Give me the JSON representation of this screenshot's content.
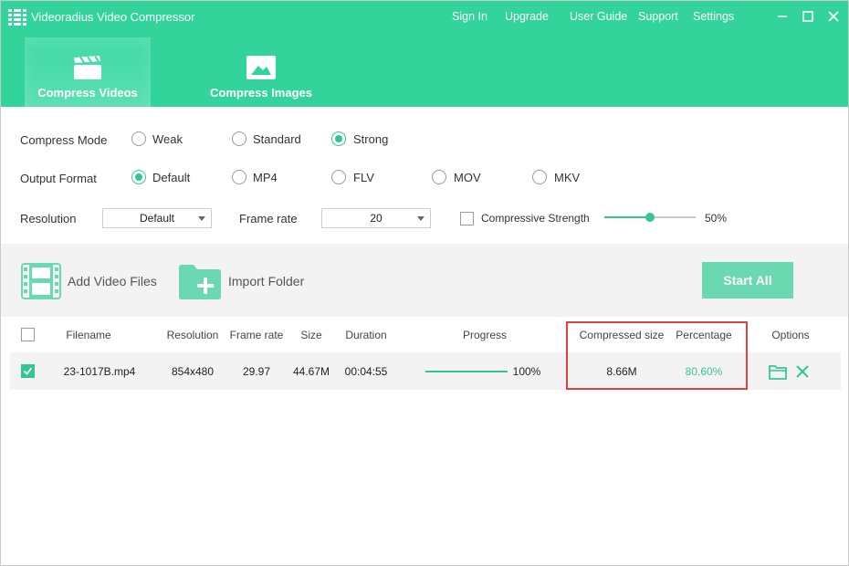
{
  "window": {
    "title": "Videoradius Video Compressor",
    "nav": [
      "Sign In",
      "Upgrade",
      "User Guide",
      "Support",
      "Settings"
    ]
  },
  "tabs": [
    {
      "label": "Compress Videos",
      "icon": "clapperboard-icon",
      "active": true
    },
    {
      "label": "Compress Images",
      "icon": "image-icon",
      "active": false
    }
  ],
  "settings": {
    "compress_mode": {
      "label": "Compress Mode",
      "options": [
        "Weak",
        "Standard",
        "Strong"
      ],
      "selected": "Strong"
    },
    "output_format": {
      "label": "Output Format",
      "options": [
        "Default",
        "MP4",
        "FLV",
        "MOV",
        "MKV"
      ],
      "selected": "Default"
    },
    "resolution": {
      "label": "Resolution",
      "value": "Default"
    },
    "frame_rate": {
      "label": "Frame rate",
      "value": "20"
    },
    "compressive_strength": {
      "label": "Compressive Strength",
      "checked": false,
      "value_text": "50%",
      "value": 50
    }
  },
  "toolbar": {
    "add_video_label": "Add Video Files",
    "import_folder_label": "Import Folder",
    "start_all_label": "Start All"
  },
  "table": {
    "columns": [
      "Filename",
      "Resolution",
      "Frame rate",
      "Size",
      "Duration",
      "Progress",
      "Compressed size",
      "Percentage",
      "Options"
    ],
    "rows": [
      {
        "checked": true,
        "filename": "23-1017B.mp4",
        "resolution": "854x480",
        "frame_rate": "29.97",
        "size": "44.67M",
        "duration": "00:04:55",
        "progress_text": "100%",
        "progress": 100,
        "compressed_size": "8.66M",
        "percentage": "80.60%"
      }
    ]
  },
  "colors": {
    "brand": "#32d49b",
    "accent": "#32c790",
    "start_button": "#6ad8b1",
    "highlight": "#e04040"
  }
}
